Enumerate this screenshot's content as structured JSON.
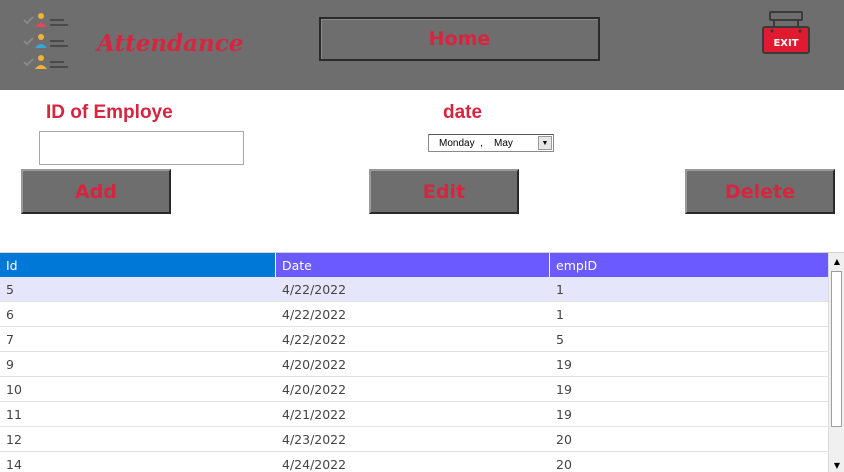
{
  "header": {
    "app_title": "Attendance",
    "home_label": "Home",
    "exit_label": "EXIT",
    "logo_icon": "checklist-people-icon",
    "exit_icon": "exit-sign-icon",
    "bg_color": "#6e6e6e",
    "accent_color": "#d8243f"
  },
  "form": {
    "employee_id_label": "ID of Employe",
    "employee_id_value": "",
    "date_label": "date",
    "date_value": "Monday  ,    May"
  },
  "actions": {
    "add_label": "Add",
    "edit_label": "Edit",
    "delete_label": "Delete"
  },
  "grid": {
    "columns": [
      "Id",
      "Date",
      "empID"
    ],
    "rows": [
      [
        "5",
        "4/22/2022",
        "1"
      ],
      [
        "6",
        "4/22/2022",
        "1"
      ],
      [
        "7",
        "4/22/2022",
        "5"
      ],
      [
        "9",
        "4/20/2022",
        "19"
      ],
      [
        "10",
        "4/20/2022",
        "19"
      ],
      [
        "11",
        "4/21/2022",
        "19"
      ],
      [
        "12",
        "4/23/2022",
        "20"
      ],
      [
        "14",
        "4/24/2022",
        "20"
      ]
    ],
    "selected_row": 0
  }
}
